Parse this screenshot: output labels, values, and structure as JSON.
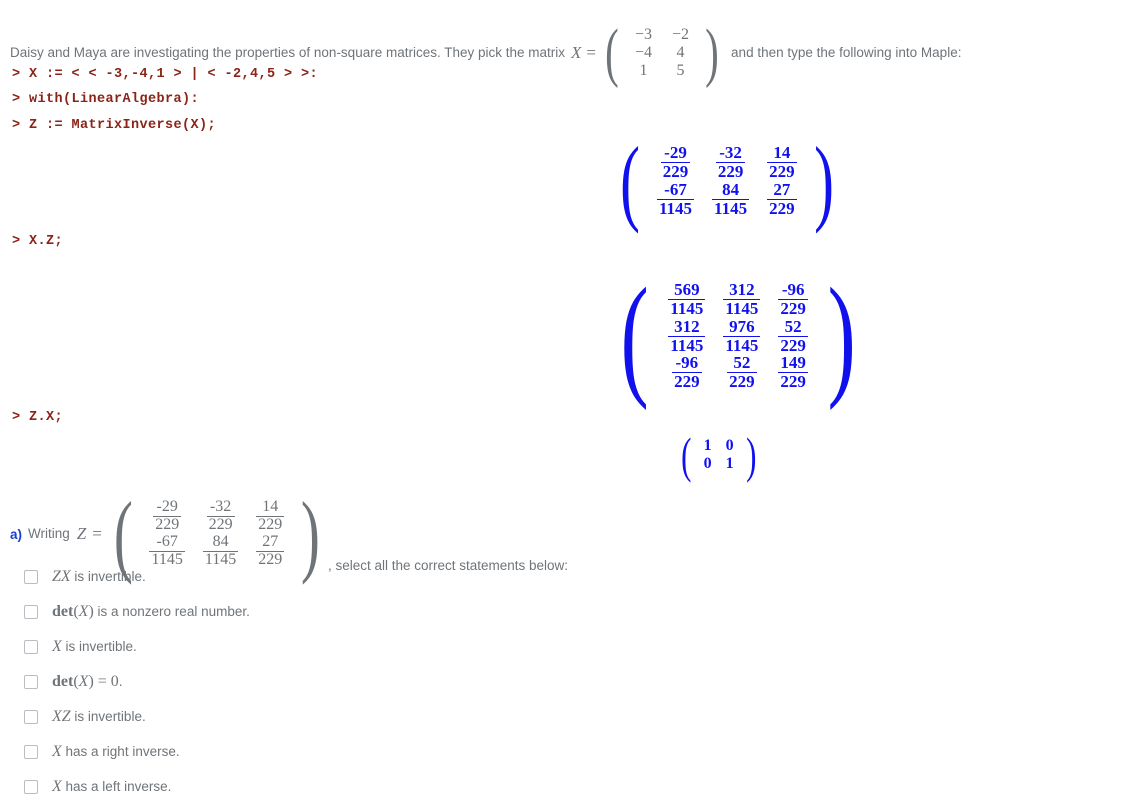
{
  "page": {
    "background": "#ffffff",
    "text_color": "#6f7479",
    "maple_color": "#8b2318",
    "output_color": "#1111ee",
    "accent_color": "#1a40d0"
  },
  "intro": {
    "text_before": "Daisy and Maya are investigating the properties of non-square matrices. They pick the matrix",
    "var_label": "X",
    "equals": "=",
    "text_after": "and then type the following into Maple:",
    "matrix_X": {
      "rows": 3,
      "cols": 2,
      "values": [
        [
          "−3",
          "−2"
        ],
        [
          "−4",
          "4"
        ],
        [
          "1",
          "5"
        ]
      ]
    }
  },
  "maple_lines": [
    {
      "id": "line-1",
      "text": "> X := < < -3,-4,1 > | < -2,4,5 > >:"
    },
    {
      "id": "line-2",
      "text": "> with(LinearAlgebra):"
    },
    {
      "id": "line-3",
      "text": "> Z := MatrixInverse(X);"
    },
    {
      "id": "line-4",
      "text": "> X.Z;"
    },
    {
      "id": "line-5",
      "text": "> Z.X;"
    }
  ],
  "output_Z": {
    "rows": 2,
    "cols": 3,
    "cells": [
      [
        {
          "n": "-29",
          "d": "229"
        },
        {
          "n": "-32",
          "d": "229"
        },
        {
          "n": "14",
          "d": "229"
        }
      ],
      [
        {
          "n": "-67",
          "d": "1145"
        },
        {
          "n": "84",
          "d": "1145"
        },
        {
          "n": "27",
          "d": "229"
        }
      ]
    ]
  },
  "output_XZ": {
    "rows": 3,
    "cols": 3,
    "cells": [
      [
        {
          "n": "569",
          "d": "1145"
        },
        {
          "n": "312",
          "d": "1145"
        },
        {
          "n": "-96",
          "d": "229"
        }
      ],
      [
        {
          "n": "312",
          "d": "1145"
        },
        {
          "n": "976",
          "d": "1145"
        },
        {
          "n": "52",
          "d": "229"
        }
      ],
      [
        {
          "n": "-96",
          "d": "229"
        },
        {
          "n": "52",
          "d": "229"
        },
        {
          "n": "149",
          "d": "229"
        }
      ]
    ]
  },
  "output_ZX": {
    "rows": 2,
    "cols": 2,
    "values": [
      [
        "1",
        "0"
      ],
      [
        "0",
        "1"
      ]
    ]
  },
  "question_a": {
    "label": "a)",
    "text_before": "Writing",
    "var_label": "Z",
    "equals": "=",
    "text_after": ", select all the correct statements below:",
    "matrix_Z": {
      "rows": 2,
      "cols": 3,
      "cells": [
        [
          {
            "n": "-29",
            "d": "229"
          },
          {
            "n": "-32",
            "d": "229"
          },
          {
            "n": "14",
            "d": "229"
          }
        ],
        [
          {
            "n": "-67",
            "d": "1145"
          },
          {
            "n": "84",
            "d": "1145"
          },
          {
            "n": "27",
            "d": "229"
          }
        ]
      ]
    },
    "options": [
      {
        "id": "opt-zx-invertible",
        "math": "ZX",
        "rest": " is invertible.",
        "checked": false
      },
      {
        "id": "opt-det-nonzero",
        "math": "det(X)",
        "rest": " is a nonzero real number.",
        "checked": false
      },
      {
        "id": "opt-x-invertible",
        "math": "X",
        "rest": " is invertible.",
        "checked": false
      },
      {
        "id": "opt-det-zero",
        "math": "det(X) = 0",
        "rest": ".",
        "checked": false
      },
      {
        "id": "opt-xz-invertible",
        "math": "XZ",
        "rest": " is invertible.",
        "checked": false
      },
      {
        "id": "opt-right-inverse",
        "math": "X",
        "rest": " has a right inverse.",
        "checked": false
      },
      {
        "id": "opt-left-inverse",
        "math": "X",
        "rest": " has a left inverse.",
        "checked": false
      }
    ]
  }
}
